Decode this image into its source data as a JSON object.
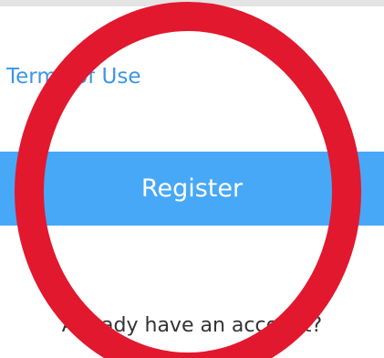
{
  "links": {
    "terms_label": "Terms of Use"
  },
  "actions": {
    "register_label": "Register"
  },
  "footer": {
    "account_text": "Already have an account?"
  },
  "colors": {
    "link": "#3c95e6",
    "primary_button": "#47a8f7",
    "annotation": "#e2182f"
  }
}
